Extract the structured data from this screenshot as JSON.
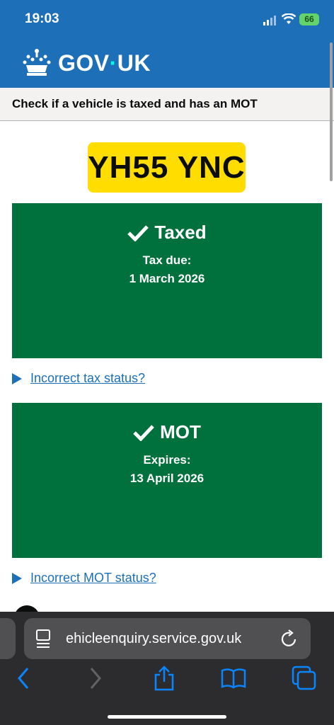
{
  "status_bar": {
    "time": "19:03",
    "battery": "66"
  },
  "header": {
    "logo_left": "GOV",
    "logo_dot": "·",
    "logo_right": "UK"
  },
  "service": {
    "name": "Check if a vehicle is taxed and has an MOT"
  },
  "plate": {
    "registration": "YH55 YNC"
  },
  "tax": {
    "title": "Taxed",
    "label": "Tax due:",
    "value": "1 March 2026",
    "details_link": "Incorrect tax status?"
  },
  "mot": {
    "title": "MOT",
    "label": "Expires:",
    "value": "13 April 2026",
    "details_link": "Incorrect MOT status?"
  },
  "browser": {
    "url": "ehicleenquiry.service.gov.uk"
  },
  "icons": [
    "signal-icon",
    "wifi-icon",
    "battery-icon",
    "crown-icon",
    "check-icon",
    "page-icon",
    "reload-icon",
    "back-icon",
    "forward-icon",
    "share-icon",
    "bookmarks-icon",
    "tabs-icon"
  ],
  "colors": {
    "govuk_blue": "#1d70b8",
    "success_green": "#00703c",
    "plate_yellow": "#ffdd00",
    "link_blue": "#1d70b8"
  }
}
